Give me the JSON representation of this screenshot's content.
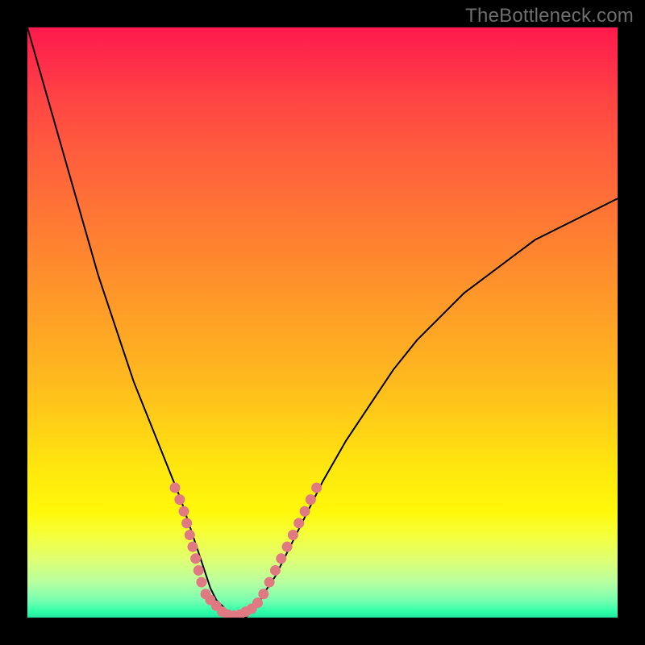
{
  "watermark": "TheBottleneck.com",
  "colors": {
    "frame": "#000000",
    "curve_stroke": "#000000",
    "marker_fill": "#e07982",
    "gradient_top": "#ff1a4d",
    "gradient_bottom": "#22e6a0"
  },
  "chart_data": {
    "type": "line",
    "title": "",
    "xlabel": "",
    "ylabel": "",
    "xlim": [
      0,
      100
    ],
    "ylim": [
      0,
      100
    ],
    "x": [
      0,
      2,
      4,
      6,
      8,
      10,
      12,
      14,
      16,
      18,
      20,
      22,
      24,
      26,
      27,
      28,
      29,
      30,
      31,
      32,
      33,
      34,
      35,
      36,
      37,
      38,
      39,
      40,
      42,
      44,
      46,
      48,
      50,
      54,
      58,
      62,
      66,
      70,
      74,
      78,
      82,
      86,
      90,
      94,
      98,
      100
    ],
    "values": [
      100,
      93,
      86,
      79,
      72,
      65,
      58,
      52,
      46,
      40,
      35,
      30,
      25,
      20,
      17,
      14,
      11,
      8,
      5,
      3,
      2,
      1,
      0,
      0,
      0,
      1,
      2,
      4,
      7,
      11,
      15,
      19,
      23,
      30,
      36,
      42,
      47,
      51,
      55,
      58,
      61,
      64,
      66,
      68,
      70,
      71
    ],
    "series": [
      {
        "name": "bottleneck_curve",
        "x": [
          0,
          2,
          4,
          6,
          8,
          10,
          12,
          14,
          16,
          18,
          20,
          22,
          24,
          26,
          27,
          28,
          29,
          30,
          31,
          32,
          33,
          34,
          35,
          36,
          37,
          38,
          39,
          40,
          42,
          44,
          46,
          48,
          50,
          54,
          58,
          62,
          66,
          70,
          74,
          78,
          82,
          86,
          90,
          94,
          98,
          100
        ],
        "y": [
          100,
          93,
          86,
          79,
          72,
          65,
          58,
          52,
          46,
          40,
          35,
          30,
          25,
          20,
          17,
          14,
          11,
          8,
          5,
          3,
          2,
          1,
          0,
          0,
          0,
          1,
          2,
          4,
          7,
          11,
          15,
          19,
          23,
          30,
          36,
          42,
          47,
          51,
          55,
          58,
          61,
          64,
          66,
          68,
          70,
          71
        ]
      }
    ],
    "markers": [
      {
        "x": 25.0,
        "y": 22
      },
      {
        "x": 25.8,
        "y": 20
      },
      {
        "x": 26.5,
        "y": 18
      },
      {
        "x": 27.0,
        "y": 16
      },
      {
        "x": 27.5,
        "y": 14
      },
      {
        "x": 28.0,
        "y": 12
      },
      {
        "x": 28.5,
        "y": 10
      },
      {
        "x": 29.0,
        "y": 8
      },
      {
        "x": 29.5,
        "y": 6
      },
      {
        "x": 30.2,
        "y": 4
      },
      {
        "x": 31.0,
        "y": 3
      },
      {
        "x": 32.0,
        "y": 2
      },
      {
        "x": 33.0,
        "y": 1
      },
      {
        "x": 34.0,
        "y": 0.5
      },
      {
        "x": 35.0,
        "y": 0.3
      },
      {
        "x": 36.0,
        "y": 0.5
      },
      {
        "x": 37.0,
        "y": 1
      },
      {
        "x": 38.0,
        "y": 1.5
      },
      {
        "x": 39.0,
        "y": 2.5
      },
      {
        "x": 40.0,
        "y": 4
      },
      {
        "x": 41.0,
        "y": 6
      },
      {
        "x": 42.0,
        "y": 8
      },
      {
        "x": 43.0,
        "y": 10
      },
      {
        "x": 44.0,
        "y": 12
      },
      {
        "x": 45.0,
        "y": 14
      },
      {
        "x": 46.0,
        "y": 16
      },
      {
        "x": 47.0,
        "y": 18
      },
      {
        "x": 48.0,
        "y": 20
      },
      {
        "x": 49.0,
        "y": 22
      }
    ]
  }
}
